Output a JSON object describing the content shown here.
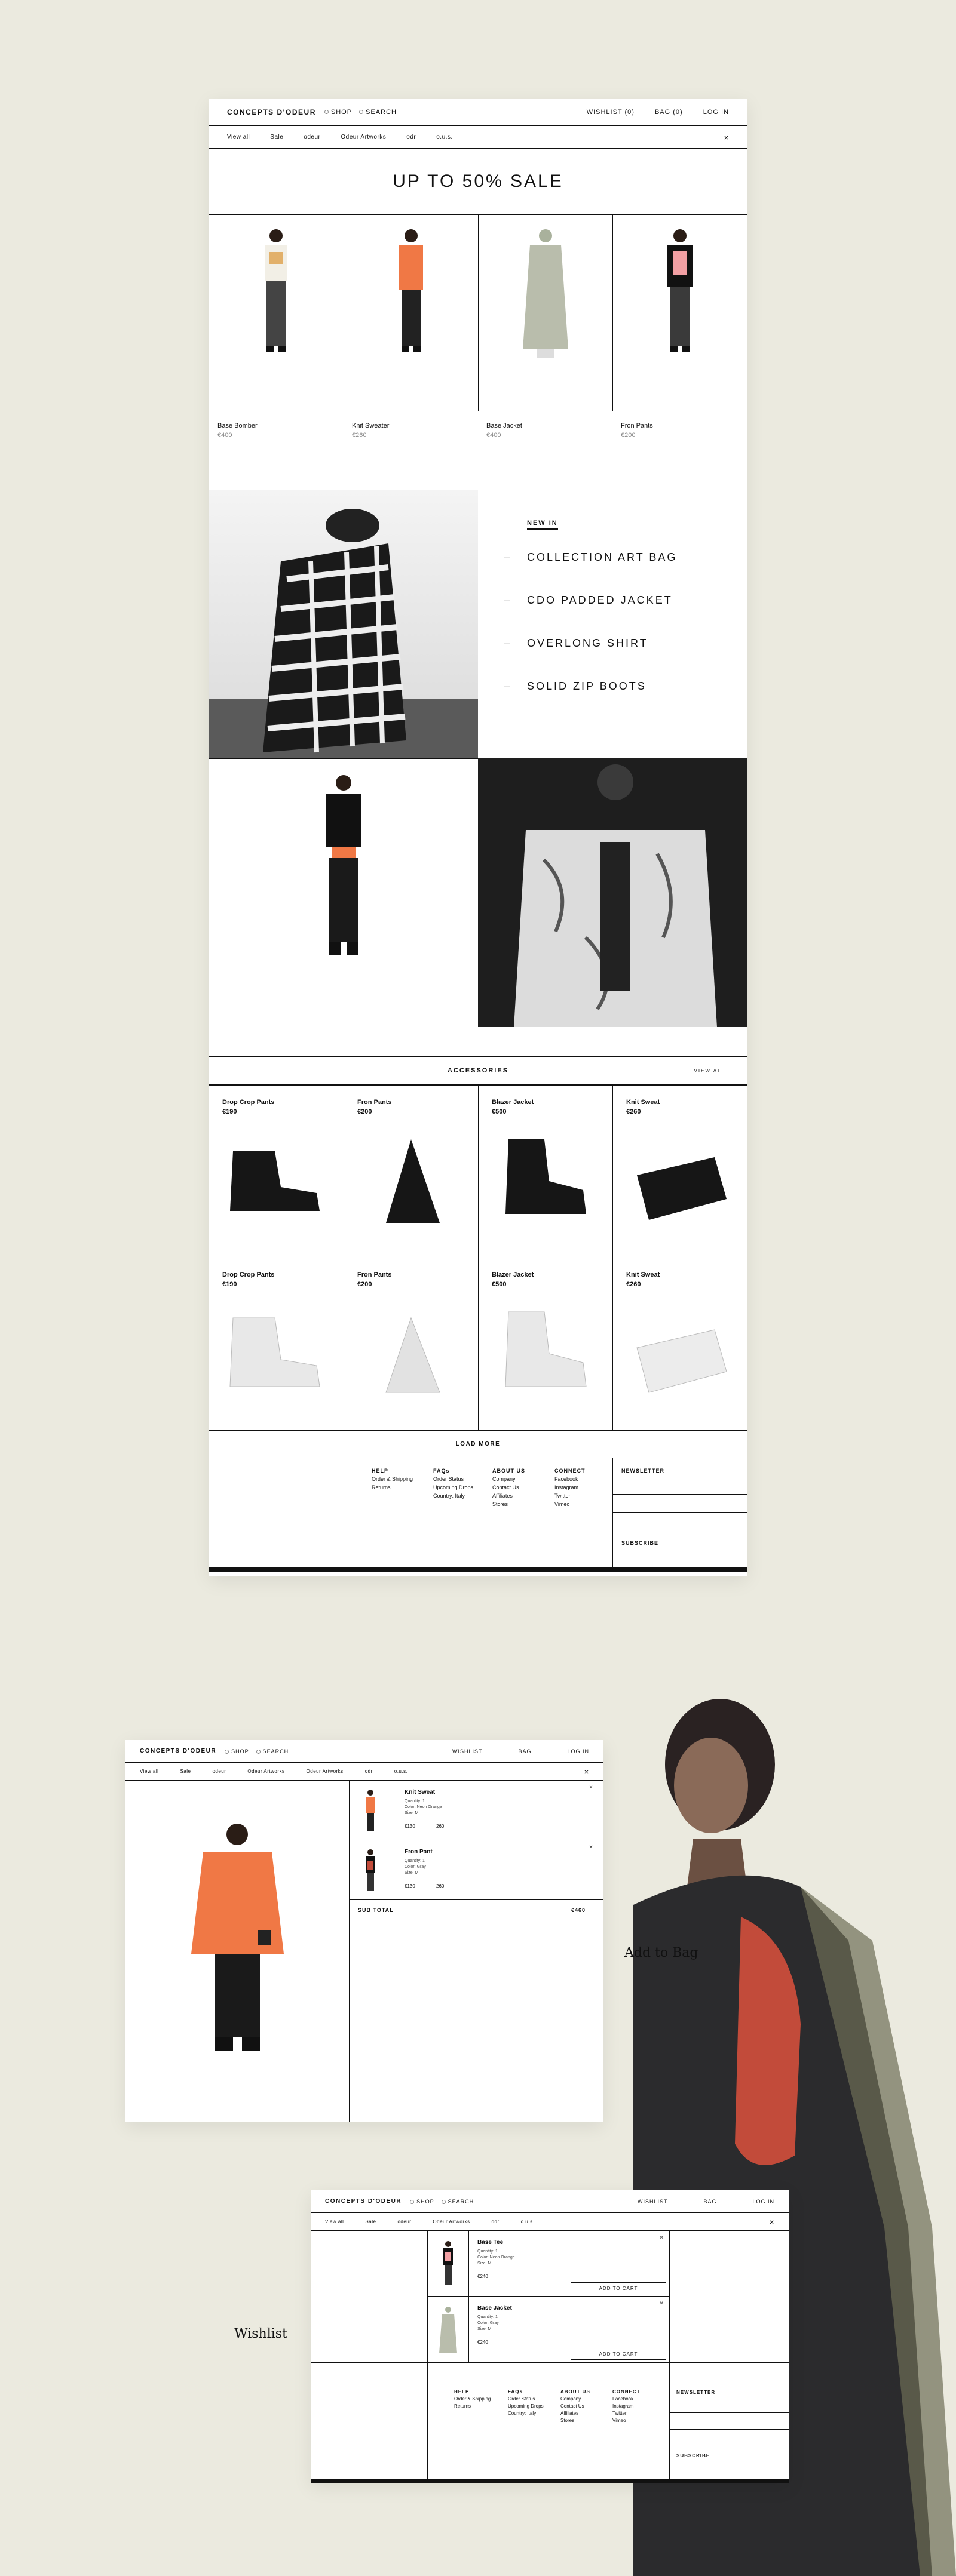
{
  "brand": "CONCEPTS D'ODEUR",
  "header": {
    "shop": "SHOP",
    "search": "SEARCH",
    "wishlist": "WISHLIST (0)",
    "bag": "BAG (0)",
    "login": "LOG IN"
  },
  "subnav": [
    "View all",
    "Sale",
    "odeur",
    "Odeur Artworks",
    "odr",
    "o.u.s."
  ],
  "hero_title": "UP TO 50% SALE",
  "sale_products": [
    {
      "name": "Base Bomber",
      "price": "€400"
    },
    {
      "name": "Knit Sweater",
      "price": "€260"
    },
    {
      "name": "Base Jacket",
      "price": "€400"
    },
    {
      "name": "Fron Pants",
      "price": "€200"
    }
  ],
  "newin": {
    "heading": "NEW IN",
    "items": [
      "COLLECTION ART BAG",
      "CDO PADDED JACKET",
      "OVERLONG SHIRT",
      "SOLID ZIP BOOTS"
    ]
  },
  "accessories": {
    "heading": "ACCESSORIES",
    "view_all": "VIEW ALL",
    "items": [
      {
        "name": "Drop Crop Pants",
        "price": "€190"
      },
      {
        "name": "Fron Pants",
        "price": "€200"
      },
      {
        "name": "Blazer Jacket",
        "price": "€500"
      },
      {
        "name": "Knit Sweat",
        "price": "€260"
      },
      {
        "name": "Drop Crop Pants",
        "price": "€190"
      },
      {
        "name": "Fron Pants",
        "price": "€200"
      },
      {
        "name": "Blazer Jacket",
        "price": "€500"
      },
      {
        "name": "Knit Sweat",
        "price": "€260"
      }
    ],
    "load_more": "LOAD MORE"
  },
  "footer": {
    "col1": {
      "title": "HELP",
      "links": [
        "Order & Shipping",
        "Returns"
      ]
    },
    "col2": {
      "title": "FAQs",
      "links": [
        "Order Status",
        "Upcoming Drops",
        "Country: Italy"
      ]
    },
    "col3": {
      "title": "ABOUT US",
      "links": [
        "Company",
        "Contact Us",
        "Affiliates",
        "Stores"
      ]
    },
    "col4": {
      "title": "CONNECT",
      "links": [
        "Facebook",
        "Instagram",
        "Twitter",
        "Vimeo"
      ]
    },
    "newsletter": "NEWSLETTER",
    "subscribe": "SUBSCRIBE"
  },
  "bag_view": {
    "header": {
      "wishlist": "WISHLIST",
      "bag": "BAG",
      "login": "LOG IN"
    },
    "subnav": [
      "View all",
      "Sale",
      "odeur",
      "Odeur Artworks",
      "Odeur Artworks",
      "odr",
      "o.u.s."
    ],
    "items": [
      {
        "name": "Knit Sweat",
        "meta": [
          "Quantity: 1",
          "Color: Neon Orange",
          "Size: M"
        ],
        "price": "€130",
        "size_label": "260"
      },
      {
        "name": "Fron Pant",
        "meta": [
          "Quantity: 1",
          "Color: Gray",
          "Size: M"
        ],
        "price": "€130",
        "size_label": "260"
      }
    ],
    "subtotal_label": "SUB TOTAL",
    "subtotal_value": "€460"
  },
  "wishlist_view": {
    "items": [
      {
        "name": "Base Tee",
        "meta": [
          "Quantity: 1",
          "Color: Neon Orange",
          "Size: M"
        ],
        "price": "€240",
        "cta": "ADD TO CART"
      },
      {
        "name": "Base Jacket",
        "meta": [
          "Quantity: 1",
          "Color: Gray",
          "Size: M"
        ],
        "price": "€240",
        "cta": "ADD TO CART"
      }
    ]
  },
  "labels": {
    "add_to_bag": "Add to Bag",
    "wishlist": "Wishlist"
  },
  "colors": {
    "background": "#ebeadf",
    "accent_orange": "#f07845",
    "ink": "#111111"
  }
}
